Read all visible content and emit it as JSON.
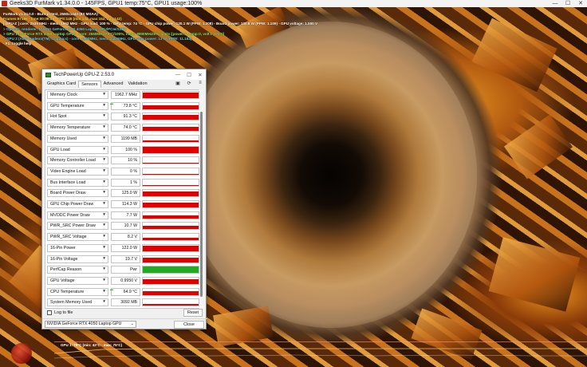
{
  "titlebar": {
    "title": "Geeks3D FurMark v1.34.0.0 - 145FPS, GPU1 temp:75°C, GPU1 usage:100%",
    "minimize": "—",
    "maximize": "☐",
    "close": "✕"
  },
  "osd": [
    {
      "text": "FurMark v1.34.0.0 - Burn-in test, 2560x1440 (8X MSAA)",
      "color": "white"
    },
    {
      "text": "Frames:67186 - time:00:08:46 - FPS:145 (min:134, max:152, avg:142)",
      "color": "yellow"
    },
    {
      "text": "[ GPU-Z ] core: 2535 MHz - mem: 1962 MHz - GPU load: 100 % - GPU temp: 74 °C - GPU chip power: 120.1 W (PPW: 1.208) - Board power: 130.8 W (PPW: 1.109) - GPU voltage: 1.000 V",
      "color": "white"
    },
    {
      "text": "> OpenGL renderer: NVIDIA GeForce RTX 4050 Laptop GPU/PCIe/SSE2",
      "color": "cyan"
    },
    {
      "text": "> GPU 1 (GeForce RTX 4050 Laptop GPU) - core: 2550MHz/75°C/100%, mem: 8800MHz/8%, limits:[power:1, temp:0, volt:0, OV:0]",
      "color": "lime"
    },
    {
      "text": "> GPU 2 (AMD Radeon(TM) Graphics) - core: 1900MHz, mem: 2400MHz, GPU chip power: 13 W (PPW: 11.154)",
      "color": "cyan"
    },
    {
      "text": "- F1: toggle help",
      "color": "white"
    }
  ],
  "graph": {
    "label": "GPU 1: 75°C (min: 42°C - max: 75°C)"
  },
  "gpuz": {
    "title": "TechPowerUp GPU-Z 2.53.0",
    "window_controls": {
      "minimize": "—",
      "maximize": "☐",
      "close": "✕"
    },
    "tabs": [
      "Graphics Card",
      "Sensors",
      "Advanced",
      "Validation"
    ],
    "active_tab": "Sensors",
    "tools": {
      "camera": "▣",
      "refresh": "⟳",
      "menu": "≡"
    },
    "sensors": [
      {
        "name": "Memory Clock",
        "value": "1962.7 MHz",
        "level": 0.85,
        "color": "#e00000",
        "spark": false
      },
      {
        "name": "GPU Temperature",
        "value": "73.8 °C",
        "level": 0.6,
        "color": "#e00000",
        "spark": true
      },
      {
        "name": "Hot Spot",
        "value": "91.3 °C",
        "level": 0.75,
        "color": "#e00000",
        "spark": false
      },
      {
        "name": "Memory Temperature",
        "value": "74.0 °C",
        "level": 0.6,
        "color": "#e00000",
        "spark": false
      },
      {
        "name": "Memory Used",
        "value": "1199 MB",
        "level": 0.2,
        "color": "#e00000",
        "spark": false
      },
      {
        "name": "GPU Load",
        "value": "100 %",
        "level": 1.0,
        "color": "#e00000",
        "spark": false
      },
      {
        "name": "Memory Controller Load",
        "value": "10 %",
        "level": 0.12,
        "color": "#e00000",
        "spark": false
      },
      {
        "name": "Video Engine Load",
        "value": "0 %",
        "level": 0.0,
        "color": "#e00000",
        "spark": false
      },
      {
        "name": "Bus Interface Load",
        "value": "1 %",
        "level": 0.03,
        "color": "#e00000",
        "spark": false
      },
      {
        "name": "Board Power Draw",
        "value": "125.0 W",
        "level": 0.8,
        "color": "#e00000",
        "spark": false
      },
      {
        "name": "GPU Chip Power Draw",
        "value": "114.3 W",
        "level": 0.8,
        "color": "#e00000",
        "spark": false
      },
      {
        "name": "MVDDC Power Draw",
        "value": "7.7 W",
        "level": 0.5,
        "color": "#e00000",
        "spark": false
      },
      {
        "name": "PWR_SRC Power Draw",
        "value": "10.7 W",
        "level": 0.5,
        "color": "#e00000",
        "spark": false
      },
      {
        "name": "PWR_SRC Voltage",
        "value": "8.2 V",
        "level": 0.45,
        "color": "#e00000",
        "spark": false
      },
      {
        "name": "16-Pin Power",
        "value": "122.0 W",
        "level": 0.8,
        "color": "#e00000",
        "spark": false
      },
      {
        "name": "16-Pin Voltage",
        "value": "19.7 V",
        "level": 0.75,
        "color": "#e00000",
        "spark": false
      },
      {
        "name": "PerfCap Reason",
        "value": "Pwr",
        "level": 1.0,
        "color": "#22aa22",
        "spark": false
      },
      {
        "name": "GPU Voltage",
        "value": "0.9950 V",
        "level": 0.7,
        "color": "#e00000",
        "spark": false
      },
      {
        "name": "CPU Temperature",
        "value": "64.9 °C",
        "level": 0.55,
        "color": "#e00000",
        "spark": true
      },
      {
        "name": "System Memory Used",
        "value": "3092 MB",
        "level": 0.3,
        "color": "#e00000",
        "spark": false
      }
    ],
    "dropdown_glyph": "▼",
    "log_label": "Log to file",
    "reset_label": "Reset",
    "gpu_select": "NVIDIA GeForce RTX 4050 Laptop GPU",
    "gpu_select_chevron": "⌄",
    "close_label": "Close"
  }
}
